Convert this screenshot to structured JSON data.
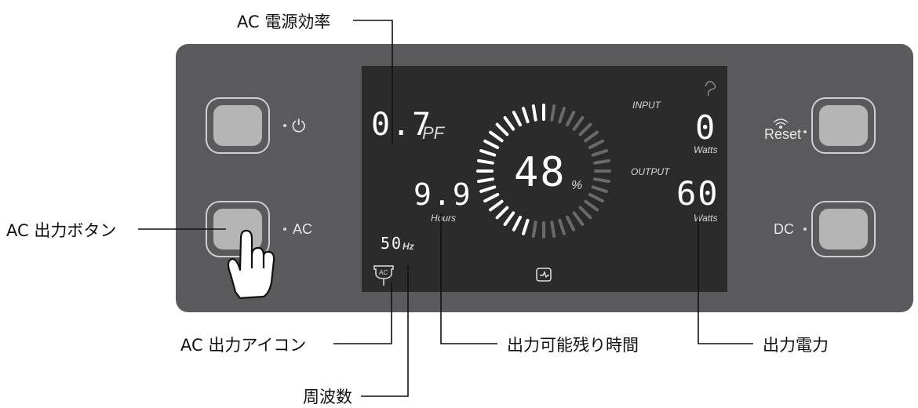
{
  "callouts": {
    "ac_efficiency": "AC 電源効率",
    "ac_button": "AC 出力ボタン",
    "ac_icon": "AC 出力アイコン",
    "frequency": "周波数",
    "remaining_time": "出力可能残り時間",
    "output_power": "出力電力"
  },
  "buttons": {
    "power_symbol": "⏻",
    "ac_label": "AC",
    "reset_label": "Reset",
    "dc_label": "DC"
  },
  "display": {
    "power_factor_value": "0.7",
    "power_factor_unit": "PF",
    "battery_percent_value": "48",
    "battery_percent_unit": "%",
    "battery_level": 0.48,
    "hours_value": "9.9",
    "hours_unit": "Hours",
    "frequency_value": "50",
    "frequency_unit": "Hz",
    "ac_icon_text": "AC",
    "input_label": "INPUT",
    "input_value": "0",
    "input_unit": "Watts",
    "output_label": "OUTPUT",
    "output_value": "60",
    "output_unit": "Watts"
  },
  "colors": {
    "panel": "#5a5a5c",
    "lcd": "#2b2b2b",
    "button_fill": "#b5b5b5",
    "segment_on": "#ffffff",
    "segment_dim": "#6a6a6a"
  }
}
